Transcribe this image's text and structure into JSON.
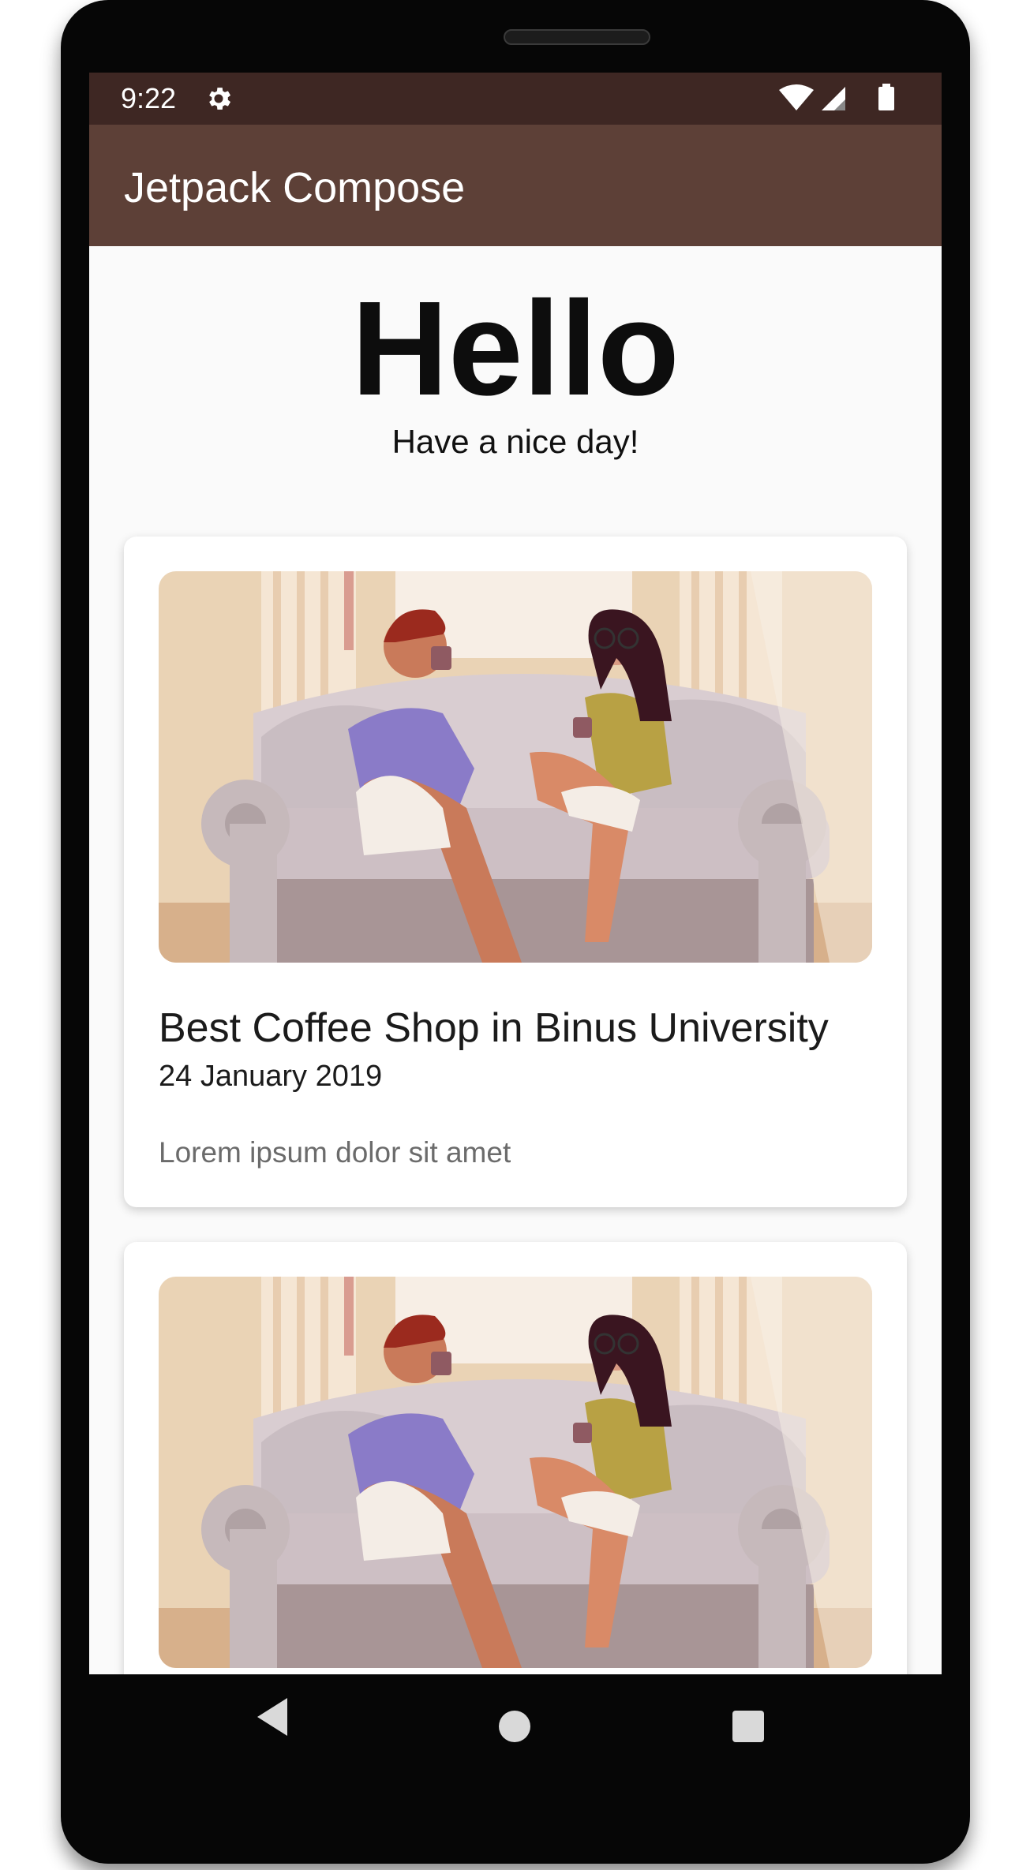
{
  "status_bar": {
    "time": "9:22",
    "icons": [
      "gear-icon",
      "wifi-icon",
      "signal-icon",
      "battery-icon"
    ]
  },
  "app_bar": {
    "title": "Jetpack Compose"
  },
  "greeting": {
    "title": "Hello",
    "subtitle": "Have a nice day!"
  },
  "cards": [
    {
      "title": "Best Coffee Shop in Binus University",
      "date": "24 January 2019",
      "description": "Lorem ipsum dolor sit amet"
    },
    {}
  ],
  "nav_bar": {
    "icons": [
      "back-icon",
      "home-icon",
      "recents-icon"
    ]
  },
  "colors": {
    "status_bar": "#3e2723",
    "app_bar": "#5d4037",
    "background": "#fafafa"
  }
}
